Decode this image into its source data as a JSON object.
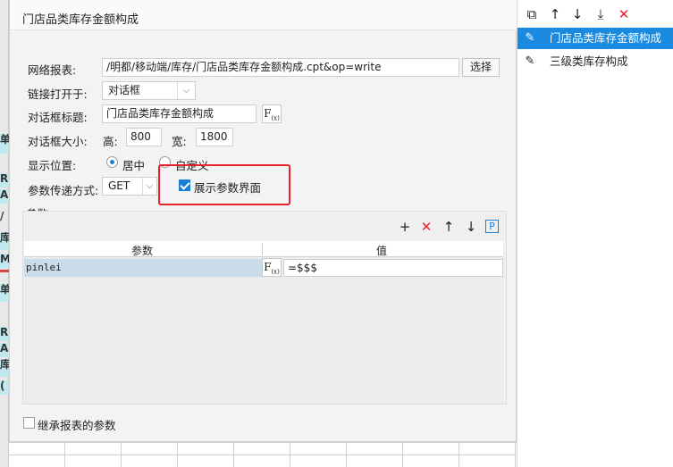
{
  "background": {
    "side_labels": [
      "单",
      "R",
      "A",
      "/",
      "库",
      "M",
      "单",
      "R",
      "A",
      "库",
      "("
    ]
  },
  "dialog": {
    "title": "门店品类库存金额构成",
    "report_label": "网络报表:",
    "report_value": "/明都/移动端/库存/门店品类库存金额构成.cpt&op=write",
    "select_button": "选择",
    "open_in_label": "链接打开于:",
    "open_in_value": "对话框",
    "dialog_title_label": "对话框标题:",
    "dialog_title_value": "门店品类库存金额构成",
    "fx_label": "F(x)",
    "size_label": "对话框大小:",
    "height_label": "高:",
    "height_value": "800",
    "width_label": "宽:",
    "width_value": "1800",
    "position_label": "显示位置:",
    "position_center": "居中",
    "position_custom": "自定义",
    "param_method_label": "参数传递方式:",
    "param_method_value": "GET",
    "show_param_ui_label": "展示参数界面",
    "show_param_ui_checked": true,
    "params_group_label": "参数",
    "table": {
      "col_param": "参数",
      "col_value": "值",
      "rows": [
        {
          "param": "pinlei",
          "value": "=$$$"
        }
      ]
    },
    "inherit_params_label": "继承报表的参数",
    "inherit_params_checked": false
  },
  "sidebar": {
    "items": [
      {
        "label": "门店品类库存金额构成",
        "selected": true
      },
      {
        "label": "三级类库存构成",
        "selected": false
      }
    ]
  },
  "colors": {
    "accent": "#1a89e0",
    "highlight_border": "#e8202a",
    "delete_red": "#e5202a",
    "selected_row": "#c9dcea"
  }
}
